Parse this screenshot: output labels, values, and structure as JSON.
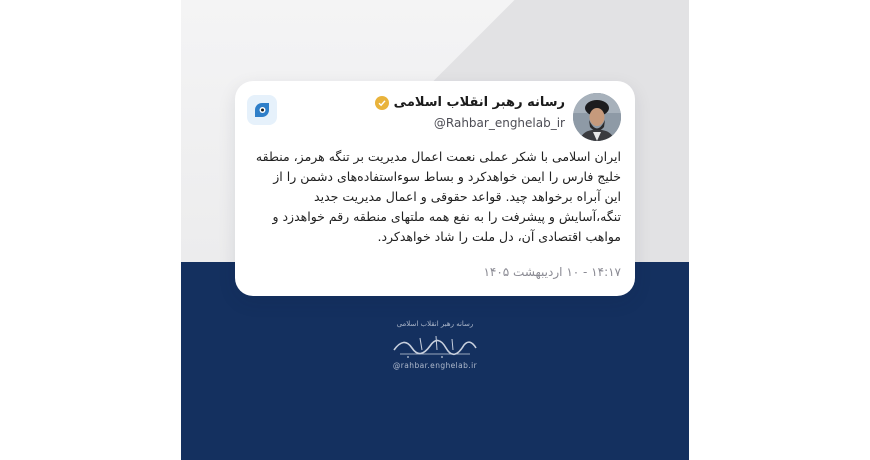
{
  "tweet": {
    "display_name": "رسانه رهبر انقلاب اسلامی",
    "handle": "@Rahbar_enghelab_ir",
    "text_lines": [
      "ایران اسلامی با شکر عملی نعمت اعمال مدیریت بر تنگه هرمز، منطقه",
      "خلیج فارس را ایمن خواهدکرد و بساط سوءاستفاده‌های دشمن را از",
      "این آبراه برخواهد چید. قواعد حقوقی و اعمال مدیریت جدید",
      "تنگه،آسایش و پیشرفت را به نفع همه ملتهای منطقه رقم خواهدزد و",
      "مواهب اقتصادی آن، دل ملت را شاد خواهدکرد."
    ],
    "timestamp": "۱۴:۱۷ - ۱۰ اردیبهشت ۱۴۰۵",
    "verified_icon": "verified-badge-icon"
  },
  "footer": {
    "org_name": "رسانه رهبر انقلاب اسلامی",
    "signature": "حضرت آیت‌الله سید مجتبی خامنه‌ای",
    "handle": "@rahbar.enghelab.ir"
  },
  "colors": {
    "navy": "#14305f",
    "card": "#ffffff",
    "verified": "#e9b33b",
    "logo_blue": "#2f7fc9"
  }
}
